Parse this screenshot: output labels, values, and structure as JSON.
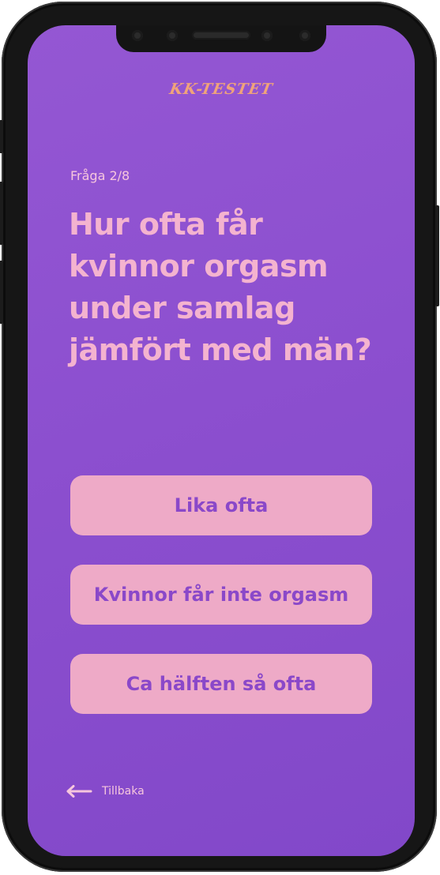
{
  "app": {
    "logo_text": "KK-TESTET"
  },
  "quiz": {
    "counter": "Fråga 2/8",
    "question_lines": [
      "Hur ofta får",
      "kvinnor orgasm",
      "under samlag",
      "jämfört med män?"
    ],
    "answers": [
      "Lika ofta",
      "Kvinnor får inte orgasm",
      "Ca hälften så ofta"
    ]
  },
  "nav": {
    "back_label": "Tillbaka",
    "back_icon": "arrow-left-icon"
  },
  "colors": {
    "background": "#8c4fcf",
    "question_text": "#f4b3cf",
    "answer_button": "#eeaac7",
    "answer_text": "#8a48c9",
    "logo": "#f0a37a"
  }
}
